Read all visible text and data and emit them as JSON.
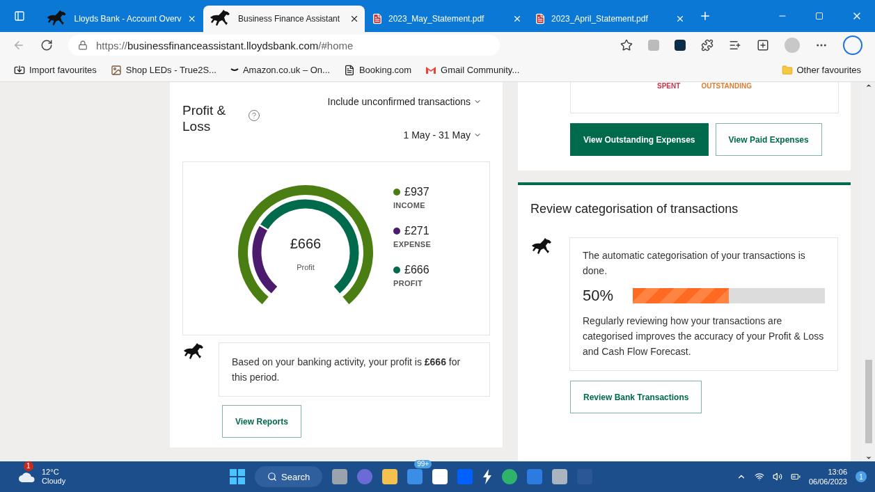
{
  "browser": {
    "tabs": [
      {
        "label": "Lloyds Bank - Account Overv",
        "kind": "horse",
        "selected": false
      },
      {
        "label": "Business Finance Assistant",
        "kind": "horse",
        "selected": true
      },
      {
        "label": "2023_May_Statement.pdf",
        "kind": "pdf",
        "selected": false
      },
      {
        "label": "2023_April_Statement.pdf",
        "kind": "pdf",
        "selected": false
      }
    ],
    "address": {
      "scheme": "https://",
      "host": "businessfinanceassistant.lloydsbank.com",
      "path": "/#home"
    },
    "favourites": [
      {
        "label": "Import favourites",
        "kind": "import"
      },
      {
        "label": "Shop LEDs - True2S...",
        "kind": "photo"
      },
      {
        "label": "Amazon.co.uk – On...",
        "kind": "amazon"
      },
      {
        "label": "Booking.com",
        "kind": "page"
      },
      {
        "label": "Gmail Community...",
        "kind": "gmail"
      }
    ],
    "other_favourites": "Other favourites"
  },
  "profit_loss": {
    "title": "Profit & Loss",
    "filter": "Include unconfirmed transactions",
    "period": "1 May - 31 May",
    "center_value": "£666",
    "center_label": "Profit",
    "legend": [
      {
        "amount": "£937",
        "label": "INCOME",
        "color": "#4a7d12"
      },
      {
        "amount": "£271",
        "label": "EXPENSE",
        "color": "#4b1b6e"
      },
      {
        "amount": "£666",
        "label": "PROFIT",
        "color": "#006a4d"
      }
    ],
    "message": "Based on your banking activity, your profit is **£666** for this period.",
    "button": "View Reports"
  },
  "expenses": {
    "labels": [
      "SPENT",
      "OUTSTANDING"
    ],
    "buttons": [
      {
        "label": "View Outstanding Expenses",
        "primary": true
      },
      {
        "label": "View Paid Expenses",
        "primary": false
      }
    ]
  },
  "review": {
    "title": "Review categorisation of transactions",
    "message": "The automatic categorisation of your transactions is done.",
    "percent": "50%",
    "level": 0.5,
    "note": "Regularly reviewing how your transactions are categorised improves the accuracy of your Profit & Loss and Cash Flow Forecast.",
    "button": "Review Bank Transactions"
  },
  "taskbar": {
    "weather": {
      "badge": "1",
      "temperature": "12°C",
      "condition": "Cloudy"
    },
    "search": "Search",
    "mail_badge": "99+",
    "time": "13:06",
    "date": "06/06/2023",
    "notifications": "1"
  }
}
